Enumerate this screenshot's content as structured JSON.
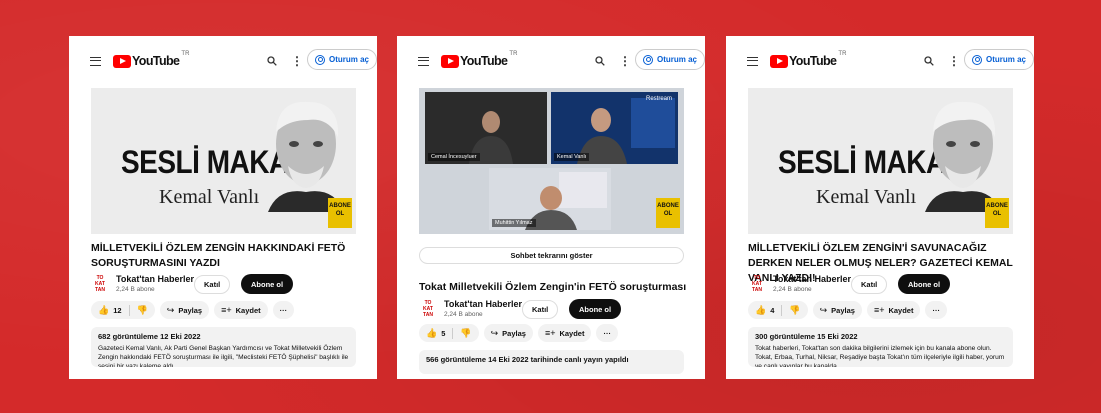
{
  "header": {
    "logo_text": "YouTube",
    "region": "TR",
    "signin_label": "Oturum aç"
  },
  "thumbnails": {
    "article_title": "SESLİ MAKALE",
    "article_author": "Kemal Vanlı",
    "badge_text": "ABONE OL",
    "call_participants": [
      "Cemal İncesuyluer",
      "Kemal Vanlı",
      "Muhittin Yılmaz"
    ],
    "call_overlay_text": "Restream"
  },
  "channel": {
    "name": "Tokat'tan Haberler",
    "subs": "2,24 B abone",
    "logo_text": "TO KAT TAN",
    "join_label": "Katıl",
    "subscribe_label": "Abone ol"
  },
  "actions": {
    "share_label": "Paylaş",
    "save_label": "Kaydet",
    "more_label": "···"
  },
  "cards": [
    {
      "title": "MİLLETVEKİLİ ÖZLEM ZENGİN HAKKINDAKİ FETÖ SORUŞTURMASINI YAZDI",
      "likes": "12",
      "meta": "682 görüntüleme  12 Eki 2022",
      "desc": "Gazeteci Kemal Vanlı, Ak Parti Genel Başkan Yardımcısı ve Tokat Milletvekili Özlem Zengin hakkındaki FETÖ soruşturması ile ilgili, \"Meclisteki FETÖ Şüphelisi\" başlıklı ile sesini bir yazı kaleme aldı."
    },
    {
      "title": "Tokat Milletvekili Özlem Zengin'in FETÖ soruşturması",
      "likes": "5",
      "chat_label": "Sohbet tekrarını göster",
      "meta": "566 görüntüleme  14 Eki 2022 tarihinde canlı yayın yapıldı"
    },
    {
      "title": "MİLLETVEKİLİ ÖZLEM ZENGİN'İ SAVUNACAĞIZ DERKEN NELER OLMUŞ NELER? GAZETECİ KEMAL VANLI YAZDI!",
      "likes": "4",
      "meta": "300 görüntüleme  15 Eki 2022",
      "desc": "Tokat haberleri, Tokat'tan son dakika bilgilerini izlemek için bu kanala abone olun. Tokat, Erbaa, Turhal, Niksar, Reşadiye başta Tokat'ın tüm ilçeleriyle ilgili haber, yorum ve canlı yayınlar bu kanalda."
    }
  ],
  "colors": {
    "background": "#d42a2a",
    "youtube_red": "#ff0000",
    "link_blue": "#065fd4"
  }
}
